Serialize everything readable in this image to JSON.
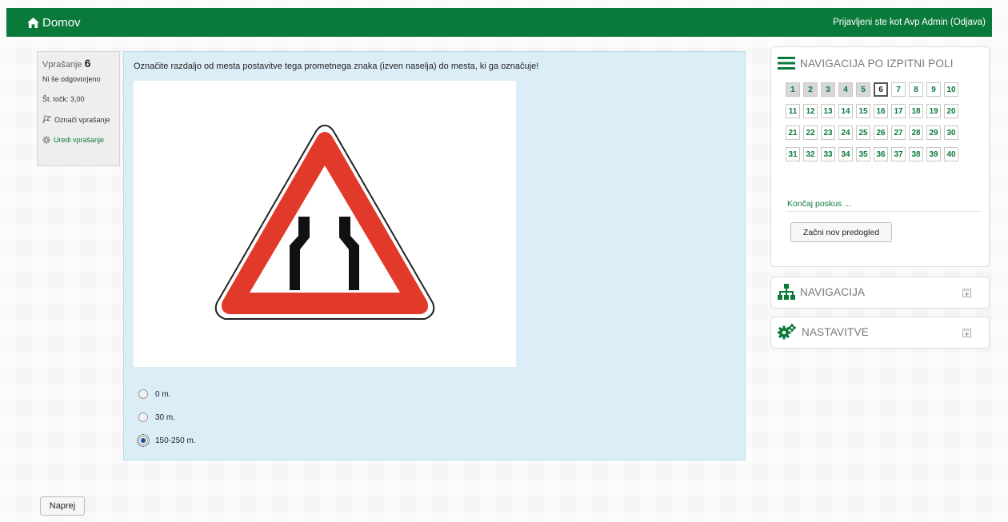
{
  "topbar": {
    "home_label": "Domov",
    "login_text": "Prijavljeni ste kot Avp Admin",
    "logout_label": "(Odjava)"
  },
  "question_info": {
    "label": "Vprašanje",
    "number": "6",
    "status": "Ni še odgovorjeno",
    "points": "Št. točk: 3,00",
    "flag_label": "Označi vprašanje",
    "edit_label": "Uredi vprašanje"
  },
  "question": {
    "text": "Označite razdaljo od mesta postavitve tega prometnega znaka (izven naselja) do mesta, ki ga označuje!",
    "image_icon": "road-narrows-warning-sign",
    "answers": [
      {
        "label": "0 m.",
        "checked": false
      },
      {
        "label": "30 m.",
        "checked": false
      },
      {
        "label": "150-250 m.",
        "checked": true
      }
    ]
  },
  "next_button": "Naprej",
  "quiz_navigation": {
    "title": "NAVIGACIJA PO IZPITNI POLI",
    "questions": [
      "1",
      "2",
      "3",
      "4",
      "5",
      "6",
      "7",
      "8",
      "9",
      "10",
      "11",
      "12",
      "13",
      "14",
      "15",
      "16",
      "17",
      "18",
      "19",
      "20",
      "21",
      "22",
      "23",
      "24",
      "25",
      "26",
      "27",
      "28",
      "29",
      "30",
      "31",
      "32",
      "33",
      "34",
      "35",
      "36",
      "37",
      "38",
      "39",
      "40"
    ],
    "answered_count": 5,
    "current": "6",
    "finish_label": "Končaj poskus ...",
    "new_preview_label": "Začni nov predogled"
  },
  "navigation_block": {
    "title": "NAVIGACIJA",
    "icon": "sitemap-icon"
  },
  "settings_block": {
    "title": "NASTAVITVE",
    "icon": "gears-icon"
  },
  "colors": {
    "brand": "#0a7a3a",
    "question_bg": "#dbeef7",
    "sign_red": "#e23a2a"
  }
}
